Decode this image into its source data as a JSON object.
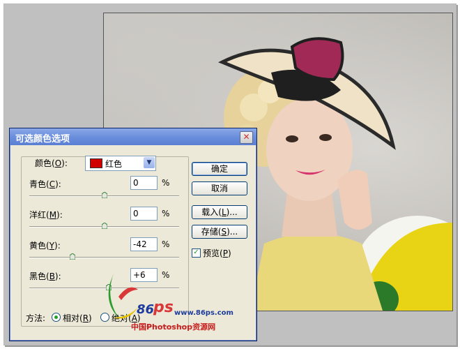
{
  "dialog": {
    "title": "可选颜色选项",
    "close_symbol": "✕",
    "colors": {
      "label_pre": "颜色(",
      "label_key": "O",
      "label_post": "):",
      "selected": "红色",
      "swatch_color": "#d00000"
    },
    "sliders": [
      {
        "label_pre": "青色(",
        "label_key": "C",
        "label_post": "):",
        "value": "0",
        "unit": "%",
        "level_pct": 0
      },
      {
        "label_pre": "洋红(",
        "label_key": "M",
        "label_post": "):",
        "value": "0",
        "unit": "%",
        "level_pct": 0
      },
      {
        "label_pre": "黄色(",
        "label_key": "Y",
        "label_post": "):",
        "value": "-42",
        "unit": "%",
        "level_pct": -42
      },
      {
        "label_pre": "黑色(",
        "label_key": "B",
        "label_post": "):",
        "value": "+6",
        "unit": "%",
        "level_pct": 6
      }
    ],
    "buttons": {
      "ok": "确定",
      "cancel": "取消",
      "load_pre": "载入(",
      "load_key": "L",
      "load_post": ")...",
      "save_pre": "存储(",
      "save_key": "S",
      "save_post": ")..."
    },
    "preview": {
      "label_pre": "预览(",
      "label_key": "P",
      "label_post": ")",
      "checked": true,
      "check_mark": "✓"
    },
    "method": {
      "label": "方法:",
      "relative_pre": "相对(",
      "relative_key": "R",
      "relative_post": ")",
      "absolute_pre": "绝对(",
      "absolute_key": "A",
      "absolute_post": ")",
      "selected": "relative"
    }
  },
  "watermark": {
    "number": "86",
    "ps": "ps",
    "url": "www.86ps.com",
    "cn": "中国Photoshop资源网"
  },
  "colors": {
    "title_bar": "#6b8fdc",
    "dialog_bg": "#ece9d8",
    "accent_red": "#d00000"
  }
}
